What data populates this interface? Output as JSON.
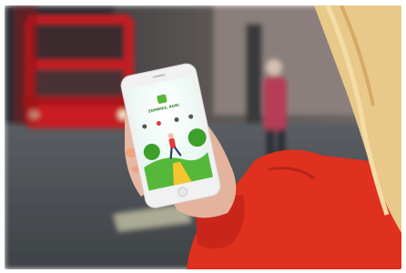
{
  "photo": {
    "scene": "street-with-bus",
    "colors": {
      "bus": "#c81d22",
      "jacket": "#e0301e",
      "hair": "#e9c98a",
      "skin": "#e7b8a3",
      "phone": "#f1f1f1",
      "app_green": "#55b83a",
      "app_sky": "#eaf7f2",
      "app_path": "#f5c531"
    }
  },
  "phone_app": {
    "logo_caption": "ZOMBIES, RUN!",
    "icons": [
      "home-icon",
      "close-icon",
      "settings-icon",
      "music-icon"
    ]
  }
}
